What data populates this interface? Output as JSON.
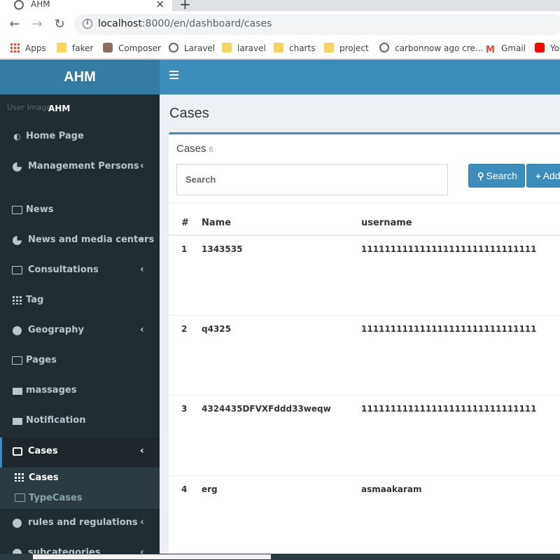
{
  "browser": {
    "tab_title": "AHM",
    "tab_close": "×",
    "new_tab": "+",
    "url_host": "localhost",
    "url_rest": ":8000/en/dashboard/cases",
    "bookmarks": [
      {
        "label": "Apps",
        "icon": "apps-icon"
      },
      {
        "label": "faker",
        "icon": "folder-icon"
      },
      {
        "label": "Composer",
        "icon": "composer-icon"
      },
      {
        "label": "Laravel",
        "icon": "globe-icon"
      },
      {
        "label": "laravel",
        "icon": "folder-icon"
      },
      {
        "label": "charts",
        "icon": "folder-icon"
      },
      {
        "label": "project",
        "icon": "folder-icon"
      },
      {
        "label": "carbonnow ago cre...",
        "icon": "globe-icon"
      },
      {
        "label": "Gmail",
        "icon": "gmail-icon"
      },
      {
        "label": "Yo",
        "icon": "youtube-icon"
      }
    ]
  },
  "app": {
    "logo": "AHM",
    "user_image_alt": "User Image",
    "user_name": "AHM"
  },
  "sidebar": {
    "items": [
      {
        "label": "Home Page",
        "icon": "dashboard-icon",
        "has_children": false
      },
      {
        "label": "Management Persons",
        "icon": "pie-chart-icon",
        "has_children": true
      },
      {
        "label": "News",
        "icon": "newspaper-icon",
        "has_children": false
      },
      {
        "label": "News and media centers",
        "icon": "pie-chart-icon",
        "has_children": true
      },
      {
        "label": "Consultations",
        "icon": "newspaper-icon",
        "has_children": true
      },
      {
        "label": "Tag",
        "icon": "grid-icon",
        "has_children": false
      },
      {
        "label": "Geography",
        "icon": "globe-icon",
        "has_children": true
      },
      {
        "label": "Pages",
        "icon": "newspaper-icon",
        "has_children": false
      },
      {
        "label": "massages",
        "icon": "envelope-icon",
        "has_children": false
      },
      {
        "label": "Notification",
        "icon": "envelope-icon",
        "has_children": false
      },
      {
        "label": "Cases",
        "icon": "medkit-icon",
        "has_children": true,
        "active": true
      },
      {
        "label": "rules and regulations",
        "icon": "globe-icon",
        "has_children": true
      },
      {
        "label": "subcategories",
        "icon": "globe-icon",
        "has_children": true
      }
    ],
    "submenu": [
      {
        "label": "Cases",
        "icon": "grid-icon",
        "active": true
      },
      {
        "label": "TypeCases",
        "icon": "newspaper-icon",
        "active": false
      }
    ],
    "chevron": "‹"
  },
  "content": {
    "page_title": "Cases",
    "box_title": "Cases",
    "box_count": "6",
    "search_placeholder": "Search",
    "search_button": "Search",
    "add_button": "Add",
    "columns": [
      "#",
      "Name",
      "username"
    ],
    "rows": [
      {
        "num": "1",
        "name": "1343535",
        "username": "111111111111111111111111111111"
      },
      {
        "num": "2",
        "name": "q4325",
        "username": "111111111111111111111111111111"
      },
      {
        "num": "3",
        "name": "4324435DFVXFddd33weqw",
        "username": "111111111111111111111111111111"
      },
      {
        "num": "4",
        "name": "erg",
        "username": "asmaakaram"
      }
    ]
  },
  "colors": {
    "header": "#3c8dbc",
    "logo_bg": "#357ca5",
    "sidebar": "#222d32",
    "content_bg": "#ecf0f5"
  }
}
